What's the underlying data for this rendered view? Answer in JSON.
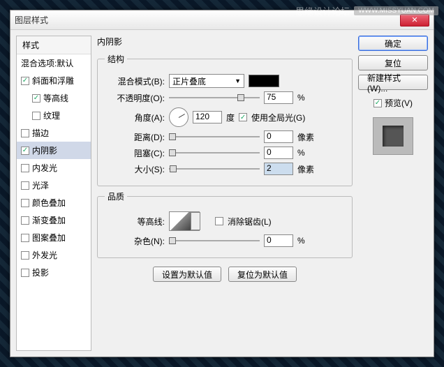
{
  "watermark": {
    "text": "思缘设计论坛",
    "url": "WWW.MISSYUAN.COM"
  },
  "dialog": {
    "title": "图层样式"
  },
  "sidebar": {
    "header": "样式",
    "blending": "混合选项:默认",
    "items": [
      {
        "label": "斜面和浮雕",
        "checked": true,
        "indent": false
      },
      {
        "label": "等高线",
        "checked": true,
        "indent": true
      },
      {
        "label": "纹理",
        "checked": false,
        "indent": true
      },
      {
        "label": "描边",
        "checked": false,
        "indent": false
      },
      {
        "label": "内阴影",
        "checked": true,
        "indent": false,
        "selected": true
      },
      {
        "label": "内发光",
        "checked": false,
        "indent": false
      },
      {
        "label": "光泽",
        "checked": false,
        "indent": false
      },
      {
        "label": "颜色叠加",
        "checked": false,
        "indent": false
      },
      {
        "label": "渐变叠加",
        "checked": false,
        "indent": false
      },
      {
        "label": "图案叠加",
        "checked": false,
        "indent": false
      },
      {
        "label": "外发光",
        "checked": false,
        "indent": false
      },
      {
        "label": "投影",
        "checked": false,
        "indent": false
      }
    ]
  },
  "main": {
    "title": "内阴影",
    "structure": {
      "legend": "结构",
      "blend_mode_label": "混合模式(B):",
      "blend_mode_value": "正片叠底",
      "opacity_label": "不透明度(O):",
      "opacity_value": "75",
      "opacity_unit": "%",
      "angle_label": "角度(A):",
      "angle_value": "120",
      "angle_unit": "度",
      "global_light_label": "使用全局光(G)",
      "distance_label": "距离(D):",
      "distance_value": "0",
      "distance_unit": "像素",
      "choke_label": "阻塞(C):",
      "choke_value": "0",
      "choke_unit": "%",
      "size_label": "大小(S):",
      "size_value": "2",
      "size_unit": "像素"
    },
    "quality": {
      "legend": "品质",
      "contour_label": "等高线:",
      "antialias_label": "消除锯齿(L)",
      "noise_label": "杂色(N):",
      "noise_value": "0",
      "noise_unit": "%"
    },
    "defaults_btn": "设置为默认值",
    "reset_btn": "复位为默认值"
  },
  "right": {
    "ok": "确定",
    "cancel": "复位",
    "new_style": "新建样式(W)...",
    "preview": "预览(V)"
  }
}
